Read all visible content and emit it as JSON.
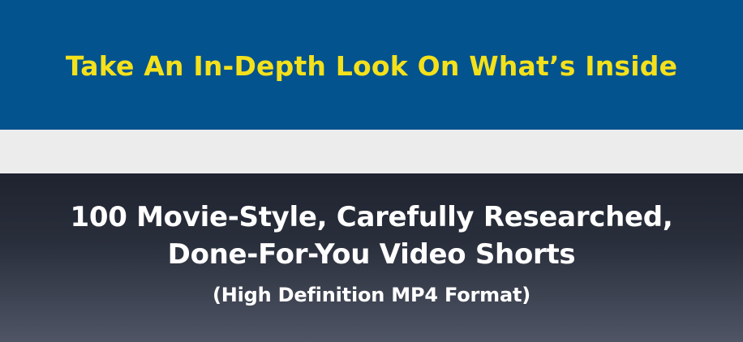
{
  "top_banner": {
    "title": "Take An In-Depth Look On What’s Inside"
  },
  "feature": {
    "title_line_1": "100 Movie-Style, Carefully Researched,",
    "title_line_2": "Done-For-You Video Shorts",
    "subtitle": "(High Definition MP4 Format)"
  },
  "colors": {
    "banner_background": "#03538f",
    "banner_text": "#f4e11b",
    "spacer_band": "#ececec",
    "feature_gradient_top": "#1f2330",
    "feature_gradient_bottom": "#4f5565",
    "feature_text": "#ffffff"
  }
}
